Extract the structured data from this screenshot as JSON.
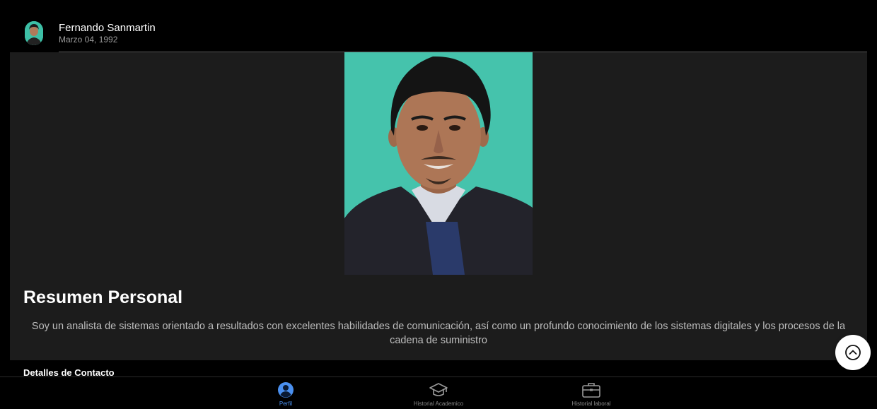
{
  "header": {
    "name": "Fernando Sanmartin",
    "birthdate": "Marzo 04, 1992"
  },
  "summary": {
    "title": "Resumen Personal",
    "text": "Soy un analista de sistemas orientado a resultados con excelentes habilidades de comunicación, así como un profundo conocimiento de los sistemas digitales y los procesos de la cadena de suministro"
  },
  "contact": {
    "title": "Detalles de Contacto"
  },
  "nav": {
    "items": [
      {
        "label": "Perfil",
        "icon": "user-circle-icon",
        "active": true
      },
      {
        "label": "Historial Academico",
        "icon": "graduation-cap-icon",
        "active": false
      },
      {
        "label": "Historial laboral",
        "icon": "briefcase-icon",
        "active": false
      }
    ]
  },
  "colors": {
    "background": "#000000",
    "card": "#1c1c1c",
    "accent": "#4a90f0",
    "photo_bg": "#45c3ac"
  },
  "icons": {
    "scroll_top": "chevron-up-circle-icon"
  }
}
